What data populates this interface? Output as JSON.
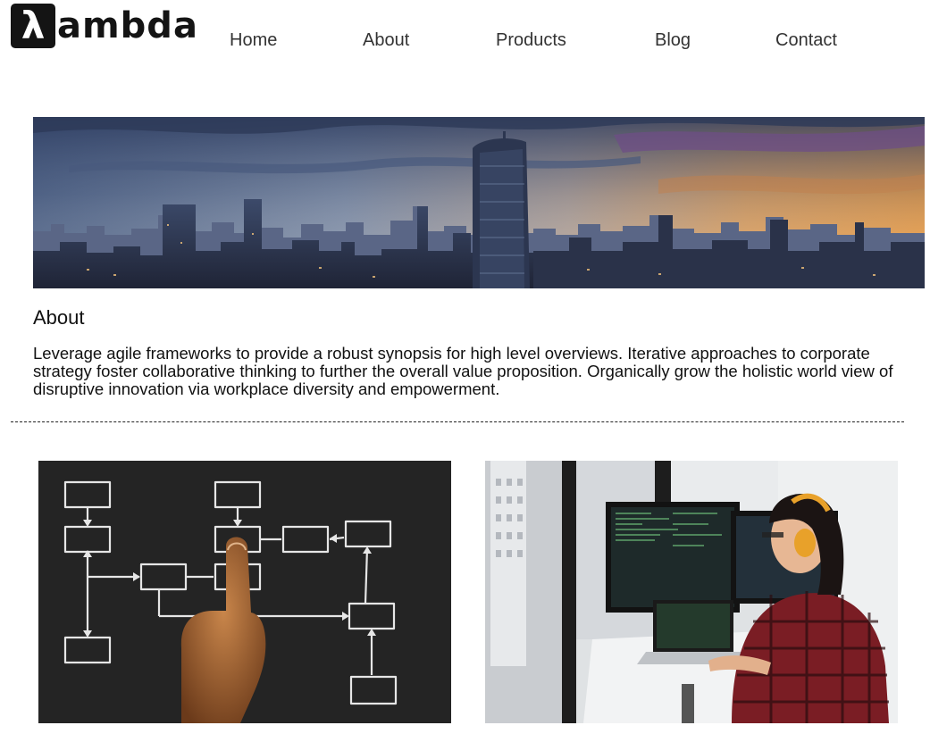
{
  "header": {
    "logo": {
      "mark": "λ",
      "text": "ambda",
      "icon": "lambda-logo-icon"
    },
    "nav": [
      {
        "label": "Home"
      },
      {
        "label": "About"
      },
      {
        "label": "Products"
      },
      {
        "label": "Blog"
      },
      {
        "label": "Contact"
      }
    ]
  },
  "hero": {
    "image": "city-skyline-sunset-banner"
  },
  "about": {
    "heading": "About",
    "body": "Leverage agile frameworks to provide a robust synopsis for high level overviews. Iterative approaches to corporate strategy foster collaborative thinking to further the overall value proposition. Organically grow the holistic world view of disruptive innovation via workplace diversity and empowerment."
  },
  "gallery": [
    {
      "image": "hand-pointing-at-chalk-flowchart"
    },
    {
      "image": "developer-with-headphones-at-monitors"
    }
  ],
  "colors": {
    "logo": "#141414",
    "nav_text": "#333333",
    "body_text": "#111111",
    "divider": "#222222"
  }
}
